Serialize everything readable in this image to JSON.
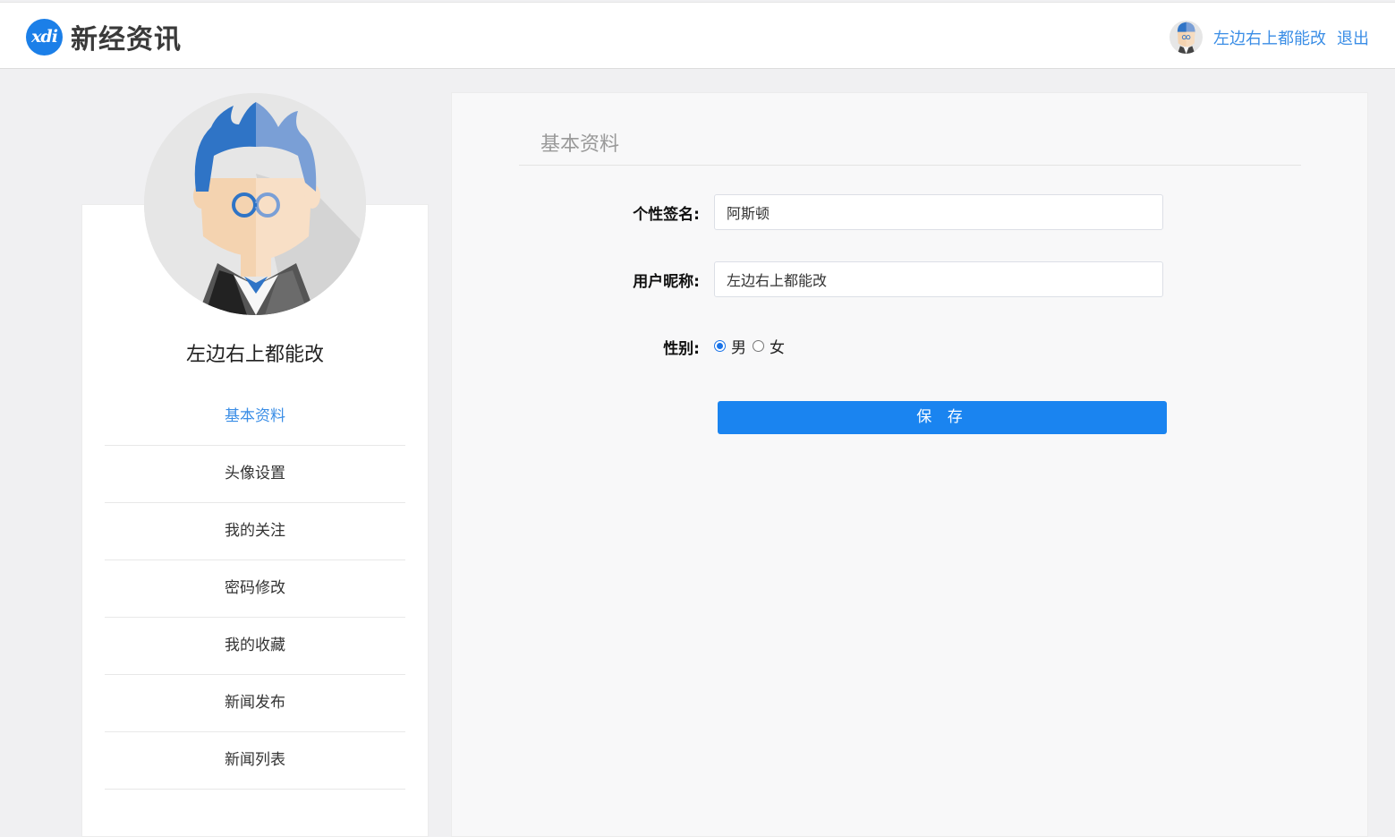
{
  "header": {
    "logo_mark": "xdi",
    "logo_text": "新经资讯",
    "user_name": "左边右上都能改",
    "logout_label": "退出"
  },
  "sidebar": {
    "profile_name": "左边右上都能改",
    "items": [
      {
        "label": "基本资料",
        "active": true
      },
      {
        "label": "头像设置",
        "active": false
      },
      {
        "label": "我的关注",
        "active": false
      },
      {
        "label": "密码修改",
        "active": false
      },
      {
        "label": "我的收藏",
        "active": false
      },
      {
        "label": "新闻发布",
        "active": false
      },
      {
        "label": "新闻列表",
        "active": false
      }
    ]
  },
  "main": {
    "section_title": "基本资料",
    "signature": {
      "label": "个性签名:",
      "value": "阿斯顿"
    },
    "nickname": {
      "label": "用户昵称:",
      "value": "左边右上都能改"
    },
    "gender": {
      "label": "性别:",
      "options": [
        {
          "label": "男",
          "checked": true
        },
        {
          "label": "女",
          "checked": false
        }
      ]
    },
    "save_label": "保 存"
  },
  "colors": {
    "accent": "#1a84f0",
    "link": "#3b8ee6",
    "avatar_hair": "#2f74c6"
  }
}
